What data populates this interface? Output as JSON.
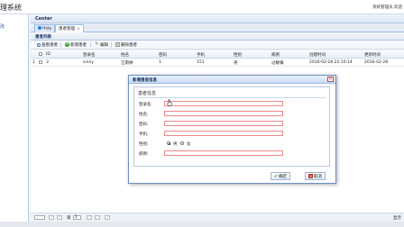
{
  "app": {
    "title": "理系统",
    "user_info": "系统管理员,欢迎"
  },
  "left": {
    "item": "改"
  },
  "center": {
    "title": "Center"
  },
  "tabs": [
    {
      "label": "Help"
    },
    {
      "label": "患者管理"
    }
  ],
  "panel": {
    "title": "患者列表"
  },
  "toolbar": {
    "search": "查看患者",
    "add": "新增患者",
    "edit": "编辑",
    "delete": "删除患者"
  },
  "grid": {
    "columns": [
      "ID",
      "登录名",
      "姓名",
      "密码",
      "手机",
      "性别",
      "病例",
      "创建时间",
      "更新时间"
    ],
    "rows": [
      {
        "num": "1",
        "id": "3",
        "login": "sinny",
        "name": "汪雨婷",
        "password": "1",
        "phone": "151",
        "gender": "男",
        "case": "过敏嗓",
        "created": "2016-02-28 22:10:14",
        "updated": "2016-02-28"
      }
    ]
  },
  "pager": {
    "page_label": "第",
    "page_value": "1",
    "right": "显示"
  },
  "dialog": {
    "title": "新增患者信息",
    "legend": "患者信息",
    "fields": {
      "login": "登录名:",
      "name": "姓名:",
      "password": "密码:",
      "phone": "手机:",
      "gender": "性别:",
      "case": "病例:"
    },
    "gender_options": {
      "male": "男",
      "female": "女"
    },
    "ok": "确定",
    "cancel": "取消"
  }
}
